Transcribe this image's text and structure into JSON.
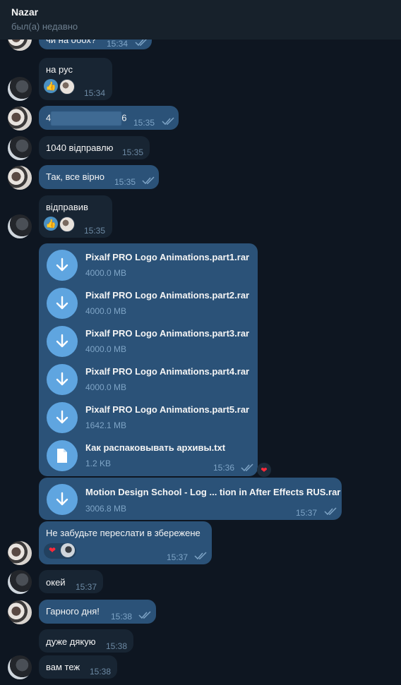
{
  "header": {
    "name": "Nazar",
    "status": "был(а) недавно"
  },
  "messages": {
    "m0": {
      "text": "чи на обох?",
      "time": "15:34"
    },
    "m1": {
      "text": "на рус",
      "time": "15:34"
    },
    "m2": {
      "text_start": "4",
      "text_end": "6",
      "time": "15:35"
    },
    "m3": {
      "text": "1040 відправлю",
      "time": "15:35"
    },
    "m4": {
      "text": "Так, все вірно",
      "time": "15:35"
    },
    "m5": {
      "text": "відправив",
      "time": "15:35"
    },
    "files": {
      "items": [
        {
          "name": "Pixalf PRO Logo Animations.part1.rar",
          "size": "4000.0 MB",
          "icon": "download-icon"
        },
        {
          "name": "Pixalf PRO Logo Animations.part2.rar",
          "size": "4000.0 MB",
          "icon": "download-icon"
        },
        {
          "name": "Pixalf PRO Logo Animations.part3.rar",
          "size": "4000.0 MB",
          "icon": "download-icon"
        },
        {
          "name": "Pixalf PRO Logo Animations.part4.rar",
          "size": "4000.0 MB",
          "icon": "download-icon"
        },
        {
          "name": "Pixalf PRO Logo Animations.part5.rar",
          "size": "1642.1 MB",
          "icon": "download-icon"
        },
        {
          "name": "Как распаковывать архивы.txt",
          "size": "1.2 KB",
          "icon": "document-icon"
        }
      ],
      "time": "15:36"
    },
    "m7": {
      "name": "Motion Design School - Log ... tion in After Effects RUS.rar",
      "size": "3006.8 MB",
      "time": "15:37"
    },
    "m8": {
      "text": "Не забудьте переслати в збережене",
      "time": "15:37"
    },
    "m9": {
      "text": "окей",
      "time": "15:37"
    },
    "m10": {
      "text": "Гарного дня!",
      "time": "15:38"
    },
    "m11": {
      "text": "дуже дякую",
      "time": "15:38"
    },
    "m12": {
      "text": "вам теж",
      "time": "15:38"
    }
  },
  "colors": {
    "background": "#0e1621",
    "incoming_bubble": "#182533",
    "outgoing_bubble": "#2b5278",
    "accent": "#5fa5e0"
  }
}
